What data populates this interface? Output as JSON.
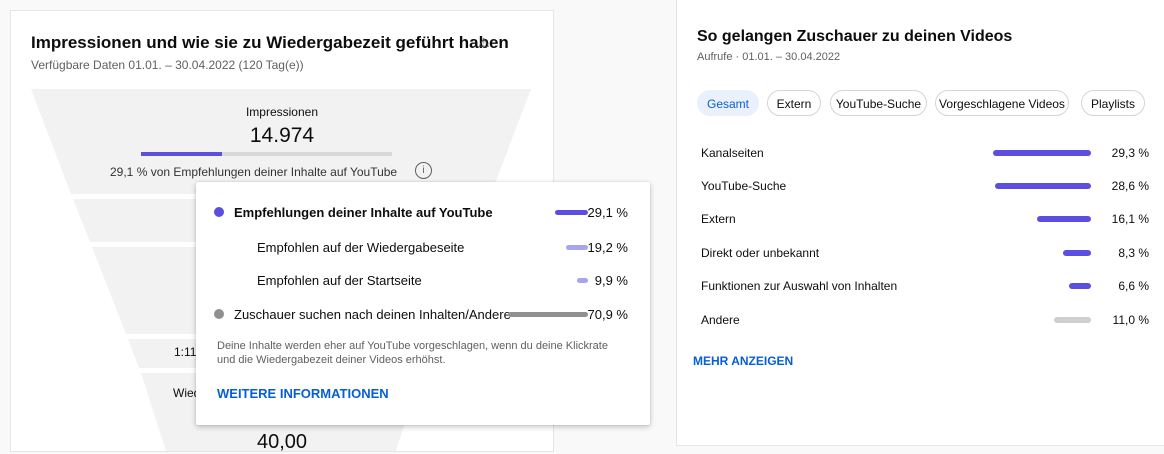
{
  "left_card": {
    "title": "Impressionen und wie sie zu Wiedergabezeit geführt haben",
    "warning_icon": "⚠",
    "subtitle": "Verfügbare Daten 01.01. – 30.04.2022 (120 Tag(e))",
    "funnel": {
      "impressions_label": "Impressionen",
      "impressions_value": "14.974",
      "progress_fraction": 0.291,
      "caption": "29,1 % von Empfehlungen deiner Inhalte auf YouTube",
      "info_icon": "i",
      "partial_label_1": "1:11",
      "partial_label_2": "Wied",
      "partial_value": "40,00"
    },
    "popup": {
      "rows": [
        {
          "label": "Empfehlungen deiner Inhalte auf YouTube",
          "value": "29,1 %",
          "bold": true,
          "dot": true,
          "color": "#5c4ee0",
          "fraction": 0.291
        },
        {
          "label": "Empfohlen auf der Wiedergabeseite",
          "value": "19,2 %",
          "bold": false,
          "dot": false,
          "color": "#a9a4ee",
          "fraction": 0.192
        },
        {
          "label": "Empfohlen auf der Startseite",
          "value": "9,9 %",
          "bold": false,
          "dot": false,
          "color": "#a9a4ee",
          "fraction": 0.099
        },
        {
          "label": "Zuschauer suchen nach deinen Inhalten/Andere",
          "value": "70,9 %",
          "bold": false,
          "dot": true,
          "color": "#909090",
          "fraction": 0.709
        }
      ],
      "note": "Deine Inhalte werden eher auf YouTube vorgeschlagen, wenn du deine Klickrate und die Wiedergabezeit deiner Videos erhöhst.",
      "link": "WEITERE INFORMATIONEN"
    }
  },
  "right_card": {
    "title": "So gelangen Zuschauer zu deinen Videos",
    "subtitle": "Aufrufe · 01.01. – 30.04.2022",
    "chips": [
      {
        "label": "Gesamt",
        "active": true
      },
      {
        "label": "Extern",
        "active": false
      },
      {
        "label": "YouTube-Suche",
        "active": false
      },
      {
        "label": "Vorgeschlagene Videos",
        "active": false
      },
      {
        "label": "Playlists",
        "active": false
      }
    ],
    "sources": [
      {
        "label": "Kanalseiten",
        "value": "29,3 %",
        "fraction": 0.293,
        "color": "#5c4ee0"
      },
      {
        "label": "YouTube-Suche",
        "value": "28,6 %",
        "fraction": 0.286,
        "color": "#5c4ee0"
      },
      {
        "label": "Extern",
        "value": "16,1 %",
        "fraction": 0.161,
        "color": "#5c4ee0"
      },
      {
        "label": "Direkt oder unbekannt",
        "value": "8,3 %",
        "fraction": 0.083,
        "color": "#5c4ee0"
      },
      {
        "label": "Funktionen zur Auswahl von Inhalten",
        "value": "6,6 %",
        "fraction": 0.066,
        "color": "#5c4ee0"
      },
      {
        "label": "Andere",
        "value": "11,0 %",
        "fraction": 0.11,
        "color": "#cfcfcf"
      }
    ],
    "more_link": "MEHR ANZEIGEN"
  }
}
